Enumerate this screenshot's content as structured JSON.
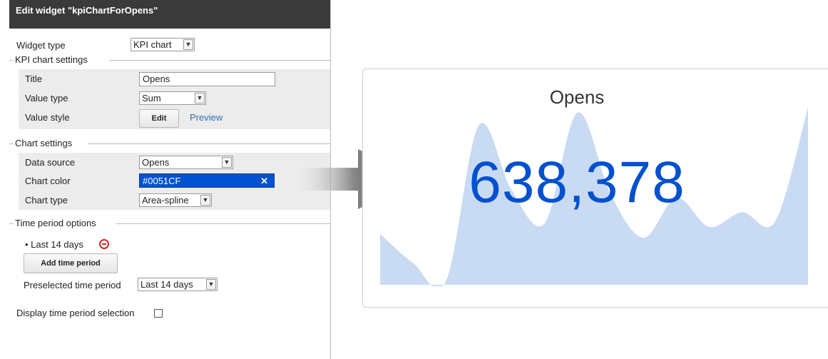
{
  "panel": {
    "title": "Edit widget \"kpiChartForOpens\"",
    "widget_type_label": "Widget type",
    "widget_type_value": "KPI chart",
    "kpi_section": "KPI chart settings",
    "title_label": "Title",
    "title_value": "Opens",
    "value_type_label": "Value type",
    "value_type_value": "Sum",
    "value_style_label": "Value style",
    "edit_button": "Edit",
    "preview_link": "Preview",
    "chart_section": "Chart settings",
    "data_source_label": "Data source",
    "data_source_value": "Opens",
    "chart_color_label": "Chart color",
    "chart_color_value": "#0051CF",
    "chart_color_clear": "✕",
    "chart_type_label": "Chart type",
    "chart_type_value": "Area-spline",
    "time_section": "Time period options",
    "time_period_item": "Last 14 days",
    "add_time_period_button": "Add time period",
    "preselected_label": "Preselected time period",
    "preselected_value": "Last 14 days",
    "display_selection_label": "Display time period selection",
    "display_selection_checked": false
  },
  "widget": {
    "title": "Opens",
    "value": "638,378",
    "value_color": "#0051CF",
    "area_color": "#C9DBF3"
  },
  "chart_data": {
    "type": "area",
    "title": "Opens",
    "x": [
      1,
      2,
      3,
      4,
      5,
      6,
      7,
      8,
      9,
      10,
      11,
      12,
      13,
      14
    ],
    "values": [
      28,
      12,
      2,
      88,
      52,
      34,
      95,
      50,
      26,
      48,
      32,
      40,
      35,
      98
    ],
    "note_values_relative": true
  }
}
